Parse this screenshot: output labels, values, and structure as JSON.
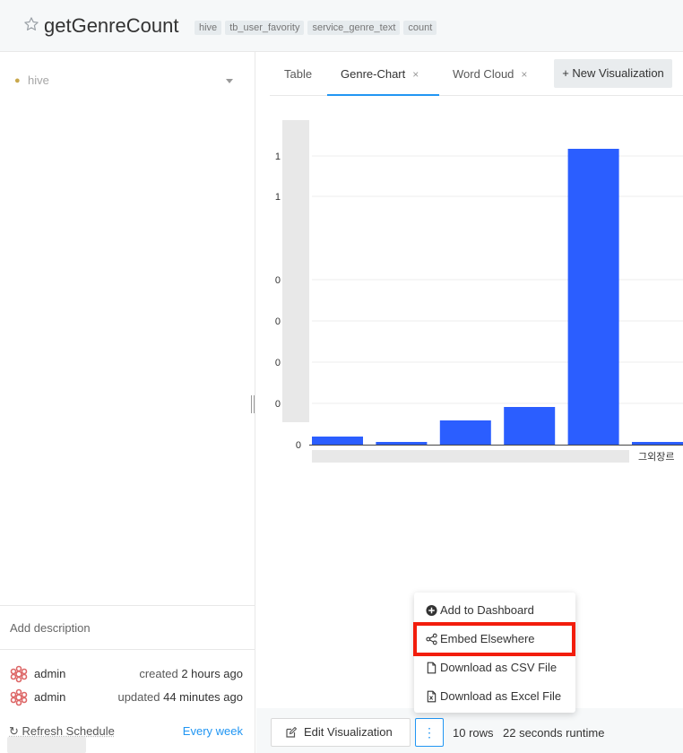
{
  "header": {
    "title": "getGenreCount",
    "tags": [
      "hive",
      "tb_user_favority",
      "service_genre_text",
      "count"
    ]
  },
  "sidebar": {
    "datasource": "hive",
    "description_placeholder": "Add description",
    "created": {
      "user": "admin",
      "label": "created",
      "time": "2 hours ago"
    },
    "updated": {
      "user": "admin",
      "label": "updated",
      "time": "44 minutes ago"
    },
    "refresh_label": "Refresh Schedule",
    "refresh_value": "Every week"
  },
  "tabs": [
    {
      "label": "Table"
    },
    {
      "label": "Genre-Chart",
      "closable": true,
      "active": true
    },
    {
      "label": "Word Cloud",
      "closable": true
    }
  ],
  "new_visualization_label": "+ New Visualization",
  "chart_data": {
    "type": "bar",
    "y_tick_labels": [
      "0",
      "0",
      "0",
      "0",
      "0",
      "1",
      "1"
    ],
    "x_tick_labels_visible": [
      "그외장르"
    ],
    "values": [
      0.03,
      0.01,
      0.09,
      0.14,
      1.1,
      0.01
    ],
    "ylim": [
      0,
      1.2
    ],
    "bar_color": "#2b5eff",
    "grid": true
  },
  "menu": {
    "items": [
      {
        "label": "Add to Dashboard",
        "icon": "plus-circle-icon"
      },
      {
        "label": "Embed Elsewhere",
        "icon": "share-icon",
        "highlighted": true
      },
      {
        "label": "Download as CSV File",
        "icon": "file-icon"
      },
      {
        "label": "Download as Excel File",
        "icon": "excel-file-icon"
      }
    ],
    "highlight_color": "#f21d0c"
  },
  "bottom": {
    "edit_label": "Edit Visualization",
    "rows": "10 rows",
    "runtime": "22 seconds runtime"
  },
  "colors": {
    "accent": "#2196f3"
  }
}
